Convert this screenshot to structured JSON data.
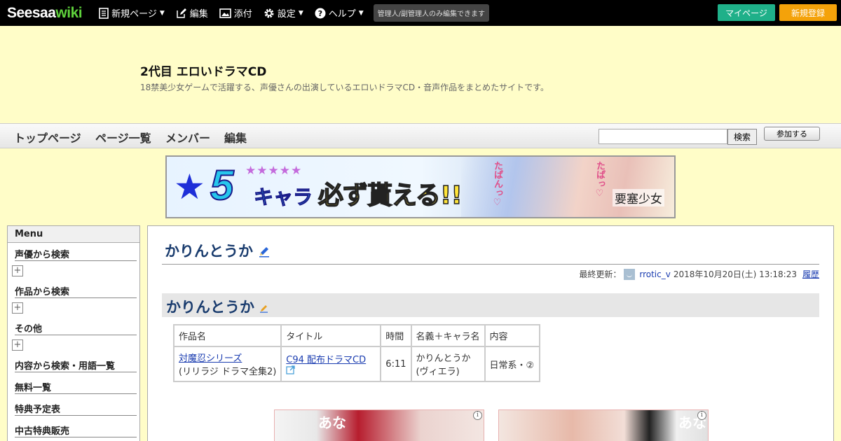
{
  "topbar": {
    "logo_main": "Seesaa",
    "logo_wiki": "wiki",
    "new_page": "新規ページ",
    "edit": "編集",
    "attach": "添付",
    "settings": "設定",
    "help": "ヘルプ",
    "note": "管理人/副管理人のみ編集できます",
    "mypage": "マイページ",
    "register": "新規登録"
  },
  "header": {
    "title": "2代目 エロいドラマCD",
    "description": "18禁美少女ゲームで活躍する、声優さんの出演しているエロいドラマCD・音声作品をまとめたサイトです。"
  },
  "nav": {
    "top": "トップページ",
    "pages": "ページ一覧",
    "members": "メンバー",
    "edit": "編集",
    "search_button": "検索",
    "join_button": "参加する"
  },
  "banner": {
    "number": "5",
    "stars": "★★★★★",
    "chara": "キャラ",
    "main_text": "必ず貰える!!",
    "side_text_1": "たぱんっ♡",
    "side_text_2": "たぱっ♡",
    "logo": "要塞少女"
  },
  "sidebar": {
    "heading": "Menu",
    "items": [
      "声優から検索",
      "作品から検索",
      "その他",
      "内容から検索・用語一覧",
      "無料一覧",
      "特典予定表",
      "中古特典販売"
    ]
  },
  "main": {
    "page_title": "かりんとうか",
    "last_updated_label": "最終更新：",
    "author": "rrotic_v",
    "updated_at": "2018年10月20日(土) 13:18:23",
    "history": "履歴",
    "section_title": "かりんとうか",
    "table": {
      "headers": [
        "作品名",
        "タイトル",
        "時間",
        "名義＋キャラ名",
        "内容"
      ],
      "row": {
        "work_link": "対魔忍シリーズ",
        "work_sub": "(リリラジ ドラマ全集2)",
        "title_link": "C94 配布ドラマCD",
        "time": "6:11",
        "name_line1": "かりんとうか",
        "name_line2": "(ヴィエラ)",
        "content": "日常系・②"
      }
    },
    "ad_info": "i",
    "ad1_text": "あな",
    "ad2_text": "あな"
  }
}
